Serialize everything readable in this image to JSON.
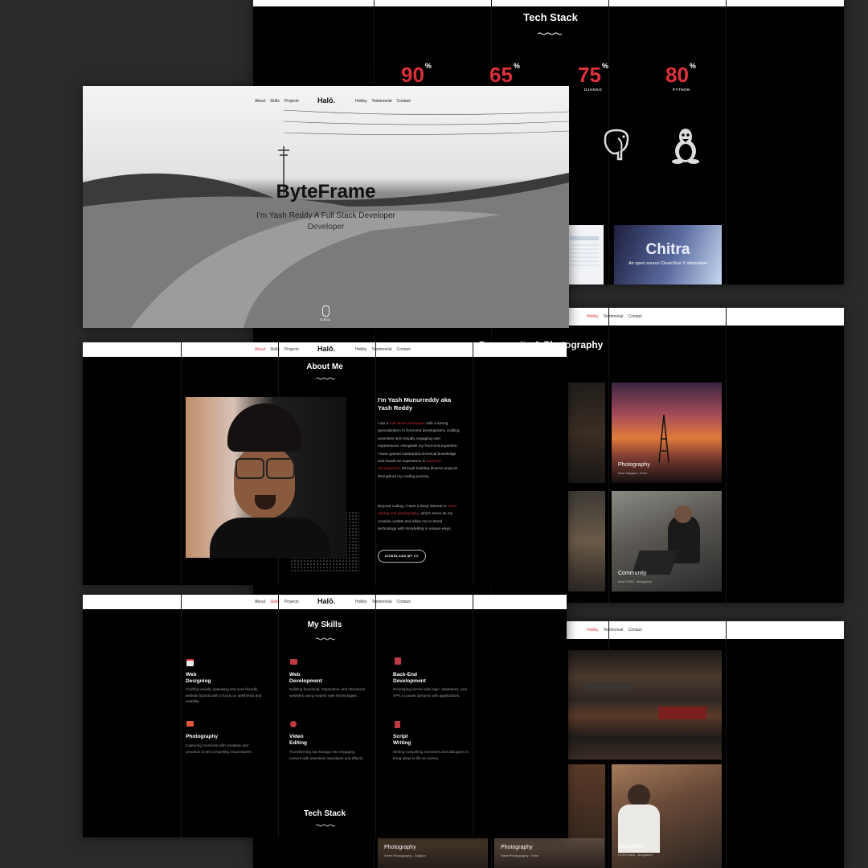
{
  "nav": {
    "left": [
      "About",
      "Skills",
      "Projects"
    ],
    "logo": "Halō.",
    "right": [
      "Hobby",
      "Testimonial",
      "Contact"
    ]
  },
  "tech_top": {
    "title": "Tech Stack",
    "stats": [
      {
        "value": "90",
        "suffix": "%",
        "label": ""
      },
      {
        "value": "65",
        "suffix": "%",
        "label": ""
      },
      {
        "value": "75",
        "suffix": "%",
        "label": "DJANGO"
      },
      {
        "value": "80",
        "suffix": "%",
        "label": "PYTHON"
      }
    ],
    "icons": [
      "postgresql-elephant-icon",
      "linux-penguin-icon"
    ],
    "project_title": "Chitra",
    "project_sub": "An open source CleanShot X alternative"
  },
  "hero": {
    "title": "ByteFrame",
    "subtitle": "I'm Yash Reddy A Full Stack Developer",
    "subtitle2": "Developer",
    "scroll": "SCROLL"
  },
  "hobby_right": {
    "title": "Community & Photography",
    "tiles": [
      {
        "title": "Photography",
        "sub": "New Sangavi - Pune"
      },
      {
        "title": "Community",
        "sub": "Infra FOSS - Bangalore"
      }
    ]
  },
  "about": {
    "title": "About Me",
    "heading": "I'm Yash Munurreddy aka Yash Reddy",
    "p1_a": "I am a ",
    "p1_hl1": "Full Stack Developer",
    "p1_b": " with a strong specialization in front-end development, crafting seamless and visually engaging user experiences. Alongside my front-end expertise, I have gained substantial technical knowledge and hands-on experience in ",
    "p1_hl2": "backend development",
    "p1_c": ", through building diverse projects throughout my coding journey.",
    "p2_a": "Beyond coding, I have a deep interest in ",
    "p2_hl": "video editing and photography",
    "p2_b": ", which serve as my creative outlets and allow me to blend technology with storytelling in unique ways.",
    "cv_button": "DOWNLOAD MY CV"
  },
  "skills": {
    "title": "My Skills",
    "items": [
      {
        "icon": "browser-window-icon",
        "title1": "Web",
        "title2": "Designing",
        "desc": "Crafting visually appealing and user-friendly website layouts with a focus on aesthetics and usability."
      },
      {
        "icon": "monitor-icon",
        "title1": "Web",
        "title2": "Development",
        "desc": "Building functional, responsive, and interactive websites using modern web technologies."
      },
      {
        "icon": "server-icon",
        "title1": "Back-End",
        "title2": "Development",
        "desc": "Developing server-side logic, databases, and APIs to power dynamic web applications."
      },
      {
        "icon": "camera-icon",
        "title1": "Photography",
        "title2": "",
        "desc": "Capturing moments with creativity and precision to tell compelling visual stories."
      },
      {
        "icon": "play-circle-icon",
        "title1": "Video",
        "title2": "Editing",
        "desc": "Transforming raw footage into engaging content with seamless transitions and effects."
      },
      {
        "icon": "document-icon",
        "title1": "Script",
        "title2": "Writing",
        "desc": "Writing compelling narratives and dialogues to bring ideas to life on screen."
      }
    ],
    "tech_title": "Tech Stack"
  },
  "bottom_right": {
    "tiles": [
      {
        "title": "Photography",
        "sub": "Street Photography - Solapur"
      },
      {
        "title": "Photography",
        "sub": "Street Photography - Pune"
      },
      {
        "title": "Hackathon",
        "sub": "FOSS Hack - Bangalore"
      }
    ]
  },
  "colors": {
    "accent": "#e0323c",
    "background": "#000000",
    "frame": "#2a2a2a"
  }
}
